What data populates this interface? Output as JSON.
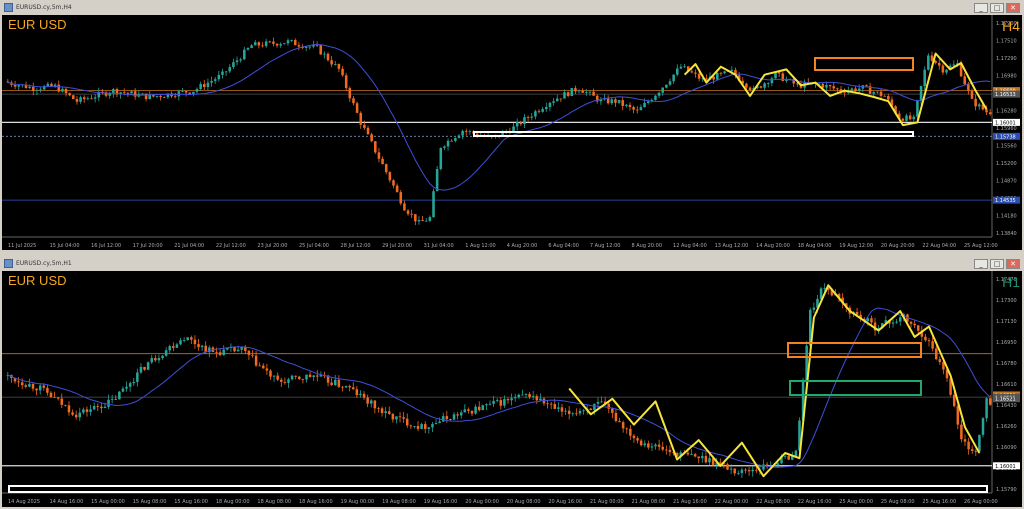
{
  "windows": [
    {
      "title": "EURUSD.cy,5m,H4",
      "buttons": [
        "_",
        "□",
        "✕"
      ]
    },
    {
      "title": "EURUSD.cy,5m,H1",
      "buttons": [
        "_",
        "□",
        "✕"
      ]
    }
  ],
  "colors": {
    "bull": "#26a69a",
    "bear": "#f26a21",
    "ma": "#3f4fd8",
    "zigzag": "#f5e53b",
    "symbol": "#f5a623",
    "tf": "#f5a623",
    "tf_h1": "#1f8c74",
    "orange_box": "#f58220",
    "green_box": "#1faa6b",
    "white_box": "#ffffff",
    "hline_orange": "#c7751a"
  },
  "chart_data": [
    {
      "type": "candlestick",
      "symbol": "EUR USD",
      "timeframe": "H4",
      "ylim": [
        1.1384,
        1.1795
      ],
      "y_ticks": [
        "1.17900",
        "1.17510",
        "1.17290",
        "1.16980",
        "1.16610",
        "1.16280",
        "1.15960",
        "1.15560",
        "1.15200",
        "1.14870",
        "1.14520",
        "1.14180",
        "1.13840"
      ],
      "price_labels": [
        "1.16600",
        "1.16533",
        "1.16001",
        "1.15738",
        "1.14535"
      ],
      "x_ticks": [
        "11 Jul 2025",
        "15 Jul 04:00",
        "16 Jul 12:00",
        "17 Jul 20:00",
        "21 Jul 04:00",
        "22 Jul 12:00",
        "23 Jul 20:00",
        "25 Jul 04:00",
        "28 Jul 12:00",
        "29 Jul 20:00",
        "31 Jul 04:00",
        "1 Aug 12:00",
        "4 Aug 20:00",
        "6 Aug 04:00",
        "7 Aug 12:00",
        "8 Aug 20:00",
        "12 Aug 04:00",
        "13 Aug 12:00",
        "14 Aug 20:00",
        "18 Aug 04:00",
        "19 Aug 12:00",
        "20 Aug 20:00",
        "22 Aug 04:00",
        "25 Aug 12:00"
      ],
      "zones": [
        {
          "kind": "orange",
          "price": 1.1715
        },
        {
          "kind": "white",
          "price": 1.1592
        }
      ],
      "hlines": [
        {
          "price": 1.166,
          "color": "orange"
        },
        {
          "price": 1.16533,
          "color": "gray"
        },
        {
          "price": 1.16001,
          "color": "white"
        },
        {
          "price": 1.15738,
          "color": "dotted"
        },
        {
          "price": 1.14535,
          "color": "blue"
        }
      ]
    },
    {
      "type": "candlestick",
      "symbol": "EUR USD",
      "timeframe": "H1",
      "ylim": [
        1.1579,
        1.1748
      ],
      "y_ticks": [
        "1.17470",
        "1.17300",
        "1.17130",
        "1.16950",
        "1.16780",
        "1.16610",
        "1.16430",
        "1.16260",
        "1.16090",
        "1.15920",
        "1.15790"
      ],
      "price_labels": [
        "1.16550",
        "1.16533",
        "1.16521",
        "1.16001"
      ],
      "x_ticks": [
        "14 Aug 2025",
        "14 Aug 16:00",
        "15 Aug 00:00",
        "15 Aug 08:00",
        "15 Aug 16:00",
        "18 Aug 00:00",
        "18 Aug 08:00",
        "18 Aug 16:00",
        "19 Aug 00:00",
        "19 Aug 08:00",
        "19 Aug 16:00",
        "20 Aug 00:00",
        "20 Aug 08:00",
        "20 Aug 16:00",
        "21 Aug 00:00",
        "21 Aug 08:00",
        "21 Aug 16:00",
        "22 Aug 00:00",
        "22 Aug 08:00",
        "22 Aug 16:00",
        "25 Aug 00:00",
        "25 Aug 08:00",
        "25 Aug 16:00",
        "26 Aug 00:00"
      ],
      "zones": [
        {
          "kind": "orange",
          "price": 1.1702
        },
        {
          "kind": "green",
          "price": 1.168
        },
        {
          "kind": "white",
          "price": 1.159
        }
      ],
      "hlines": [
        {
          "price": 1.1687,
          "color": "orange"
        },
        {
          "price": 1.16533,
          "color": "gray"
        },
        {
          "price": 1.16001,
          "color": "white"
        }
      ]
    }
  ]
}
